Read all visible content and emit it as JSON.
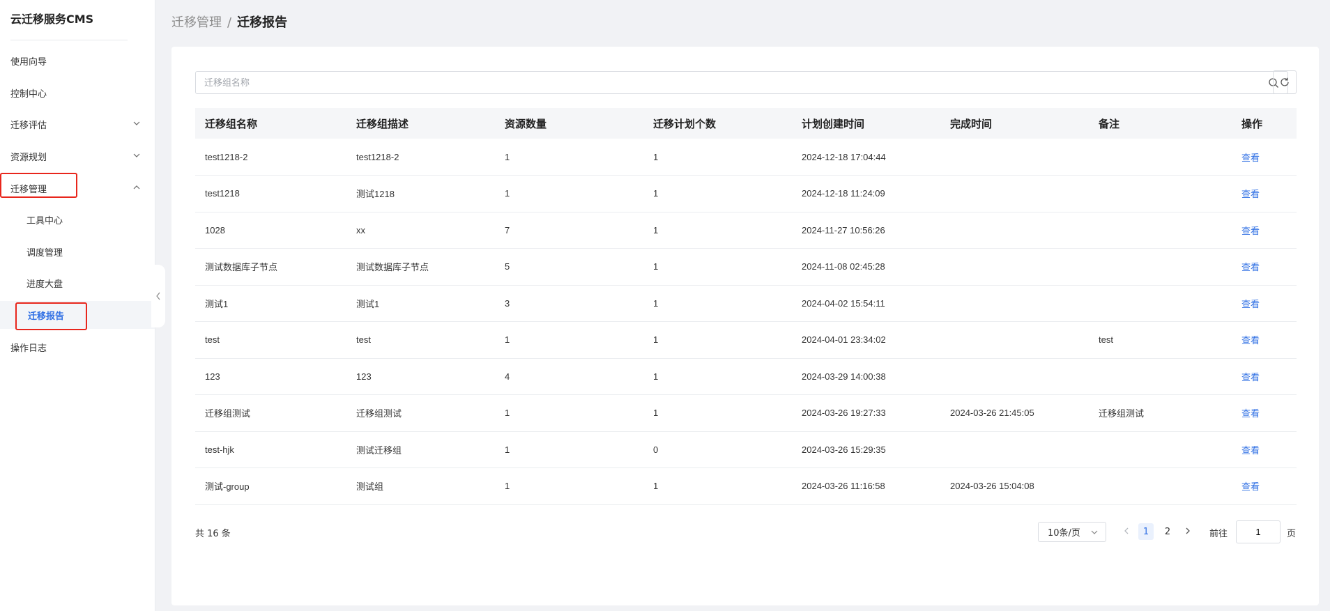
{
  "app": {
    "title": "云迁移服务CMS"
  },
  "sidebar": {
    "items": [
      {
        "label": "使用向导"
      },
      {
        "label": "控制中心"
      },
      {
        "label": "迁移评估"
      },
      {
        "label": "资源规划"
      },
      {
        "label": "迁移管理"
      },
      {
        "label": "工具中心"
      },
      {
        "label": "调度管理"
      },
      {
        "label": "进度大盘"
      },
      {
        "label": "迁移报告"
      },
      {
        "label": "操作日志"
      }
    ]
  },
  "breadcrumb": {
    "parent": "迁移管理",
    "separator": "/",
    "current": "迁移报告"
  },
  "search": {
    "placeholder": "迁移组名称",
    "value": ""
  },
  "table": {
    "columns": [
      "迁移组名称",
      "迁移组描述",
      "资源数量",
      "迁移计划个数",
      "计划创建时间",
      "完成时间",
      "备注",
      "操作"
    ],
    "rows": [
      {
        "name": "test1218-2",
        "desc": "test1218-2",
        "resources": "1",
        "plans": "1",
        "created": "2024-12-18 17:04:44",
        "finished": "",
        "note": "",
        "action": "查看"
      },
      {
        "name": "test1218",
        "desc": "测试1218",
        "resources": "1",
        "plans": "1",
        "created": "2024-12-18 11:24:09",
        "finished": "",
        "note": "",
        "action": "查看"
      },
      {
        "name": "1028",
        "desc": "xx",
        "resources": "7",
        "plans": "1",
        "created": "2024-11-27 10:56:26",
        "finished": "",
        "note": "",
        "action": "查看"
      },
      {
        "name": "测试数据库子节点",
        "desc": "测试数据库子节点",
        "resources": "5",
        "plans": "1",
        "created": "2024-11-08 02:45:28",
        "finished": "",
        "note": "",
        "action": "查看"
      },
      {
        "name": "测试1",
        "desc": "测试1",
        "resources": "3",
        "plans": "1",
        "created": "2024-04-02 15:54:11",
        "finished": "",
        "note": "",
        "action": "查看"
      },
      {
        "name": "test",
        "desc": "test",
        "resources": "1",
        "plans": "1",
        "created": "2024-04-01 23:34:02",
        "finished": "",
        "note": "test",
        "action": "查看"
      },
      {
        "name": "123",
        "desc": "123",
        "resources": "4",
        "plans": "1",
        "created": "2024-03-29 14:00:38",
        "finished": "",
        "note": "",
        "action": "查看"
      },
      {
        "name": "迁移组测试",
        "desc": "迁移组测试",
        "resources": "1",
        "plans": "1",
        "created": "2024-03-26 19:27:33",
        "finished": "2024-03-26 21:45:05",
        "note": "迁移组测试",
        "action": "查看"
      },
      {
        "name": "test-hjk",
        "desc": "测试迁移组",
        "resources": "1",
        "plans": "0",
        "created": "2024-03-26 15:29:35",
        "finished": "",
        "note": "",
        "action": "查看"
      },
      {
        "name": "测试-group",
        "desc": "测试组",
        "resources": "1",
        "plans": "1",
        "created": "2024-03-26 11:16:58",
        "finished": "2024-03-26 15:04:08",
        "note": "",
        "action": "查看"
      }
    ]
  },
  "pagination": {
    "total_text": "共 16 条",
    "page_size": "10条/页",
    "pages": [
      "1",
      "2"
    ],
    "current": "1",
    "goto_prefix": "前往",
    "goto_value": "1",
    "goto_suffix": "页"
  },
  "colors": {
    "accent": "#2f6fe4",
    "highlight": "#e8261c"
  },
  "icons": [
    "search-icon",
    "refresh-icon",
    "chevron-down-icon",
    "chevron-up-icon",
    "chevron-left-icon",
    "chevron-right-icon"
  ]
}
